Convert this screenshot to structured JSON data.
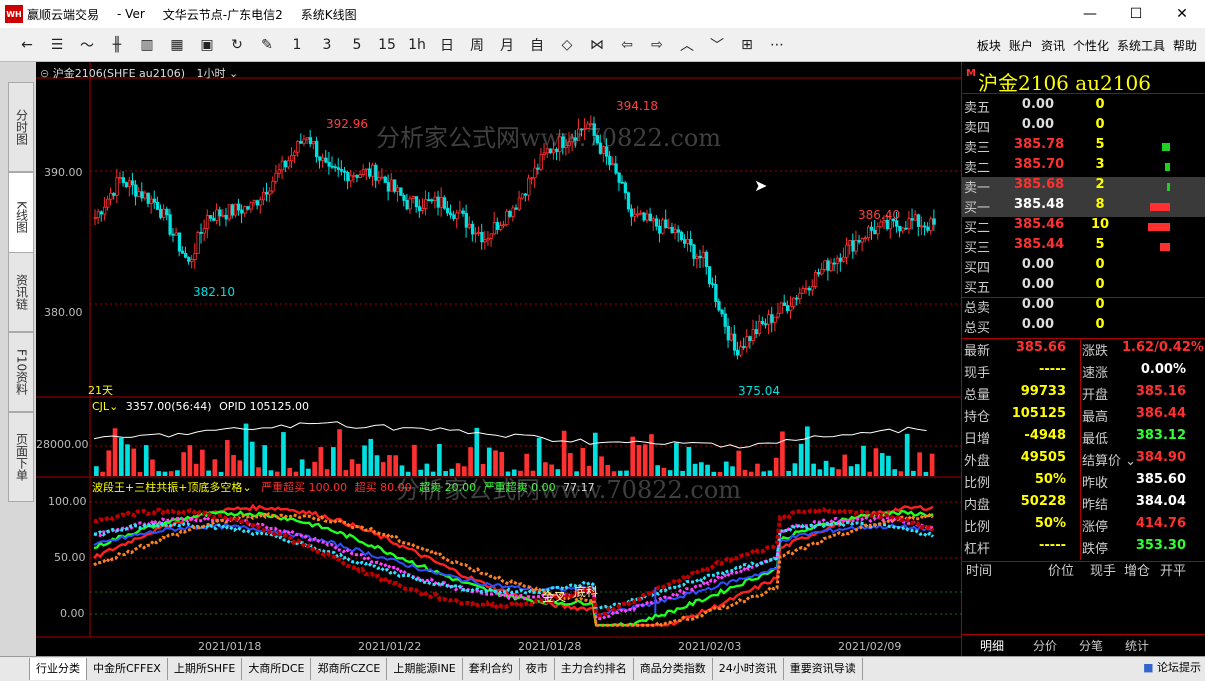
{
  "window": {
    "title_app": "赢顺云端交易",
    "title_ver": "- Ver",
    "title_node": "文华云节点-广东电信2",
    "title_view": "系统K线图",
    "min": "—",
    "max": "☐",
    "close": "✕"
  },
  "toolbar": {
    "icons": [
      "back-icon",
      "list-icon",
      "line-chart-icon",
      "bar-icon",
      "candlestick-icon",
      "multi-chart-icon",
      "save-icon",
      "refresh-icon",
      "draw-icon"
    ],
    "periods": [
      "1",
      "3",
      "5",
      "15",
      "1h",
      "日",
      "周",
      "月",
      "自"
    ],
    "menu": [
      "板块",
      "账户",
      "资讯",
      "个性化",
      "系统工具",
      "帮助"
    ]
  },
  "left_tabs": [
    "分时图",
    "K线图",
    "资讯链",
    "F10资料",
    "页面下单"
  ],
  "chart": {
    "header_name": "沪金2106(SHFE au2106)",
    "period": "1小时",
    "main_yticks": [
      {
        "label": "390.00",
        "v": 390
      },
      {
        "label": "380.00",
        "v": 380
      }
    ],
    "labels": {
      "high1": "392.96",
      "high2": "394.18",
      "low1": "382.10",
      "low2": "375.04",
      "recent": "386.40"
    },
    "period_label": "21天",
    "watermark": "分析家公式网www.70822.com",
    "vol": {
      "name": "CJL",
      "value": "3357.00(56:44)",
      "opid": "OPID 105125.00",
      "ytick": "28000.00"
    },
    "ind": {
      "name": "波段王+三柱共振+顶底多空格",
      "t1": "严重超买 100.00",
      "t2": "超买 80.00",
      "t3": "超卖 20.00",
      "t4": "严重超卖 0.00",
      "t5": "77.17",
      "yticks": [
        "100.00",
        "50.00",
        "0.00"
      ],
      "jincha": "金叉",
      "dike": "底科",
      "watermark": "分析家公式网www.70822.com"
    },
    "xticks": [
      "2021/01/18",
      "2021/01/22",
      "2021/01/28",
      "2021/02/03",
      "2021/02/09"
    ]
  },
  "quote": {
    "title": "沪金2106 au2106",
    "badge": "M",
    "asks": [
      {
        "label": "卖五",
        "price": "0.00",
        "vol": "0"
      },
      {
        "label": "卖四",
        "price": "0.00",
        "vol": "0"
      },
      {
        "label": "卖三",
        "price": "385.78",
        "vol": "5",
        "bar": 8
      },
      {
        "label": "卖二",
        "price": "385.70",
        "vol": "3",
        "bar": 5
      },
      {
        "label": "卖一",
        "price": "385.68",
        "vol": "2",
        "bar": 3
      }
    ],
    "bids": [
      {
        "label": "买一",
        "price": "385.48",
        "vol": "8",
        "bar": 20
      },
      {
        "label": "买二",
        "price": "385.46",
        "vol": "10",
        "bar": 22
      },
      {
        "label": "买三",
        "price": "385.44",
        "vol": "5",
        "bar": 10
      },
      {
        "label": "买四",
        "price": "0.00",
        "vol": "0"
      },
      {
        "label": "买五",
        "price": "0.00",
        "vol": "0"
      }
    ],
    "totals": [
      {
        "label": "总卖",
        "price": "0.00",
        "vol": "0"
      },
      {
        "label": "总买",
        "price": "0.00",
        "vol": "0"
      }
    ],
    "stats": [
      [
        "最新",
        "385.66",
        "涨跌",
        "1.62/0.42%"
      ],
      [
        "现手",
        "-----",
        "速涨",
        "0.00%"
      ],
      [
        "总量",
        "99733",
        "开盘",
        "385.16"
      ],
      [
        "持仓",
        "105125",
        "最高",
        "386.44"
      ],
      [
        "日增",
        "-4948",
        "最低",
        "383.12"
      ],
      [
        "外盘",
        "49505",
        "结算价",
        "384.90"
      ],
      [
        "比例",
        "50%",
        "昨收",
        "385.60"
      ],
      [
        "内盘",
        "50228",
        "昨结",
        "384.04"
      ],
      [
        "比例",
        "50%",
        "涨停",
        "414.76"
      ],
      [
        "杠杆",
        "-----",
        "跌停",
        "353.30"
      ]
    ],
    "trades_header": [
      "时间",
      "价位",
      "现手",
      "增仓",
      "开平"
    ],
    "tabs": [
      "明细",
      "分价",
      "分笔",
      "统计"
    ]
  },
  "status": [
    "行业分类",
    "中金所CFFEX",
    "上期所SHFE",
    "大商所DCE",
    "郑商所CZCE",
    "上期能源INE",
    "套利合约",
    "夜市",
    "主力合约排名",
    "商品分类指数",
    "24小时资讯",
    "重要资讯导读"
  ],
  "status_right": "论坛提示",
  "colors": {
    "up": "#ff3030",
    "down": "#00e0e0",
    "accent": "#ffff00"
  },
  "chart_data": {
    "type": "candlestick",
    "ylim": [
      373,
      397
    ],
    "n": 160
  }
}
